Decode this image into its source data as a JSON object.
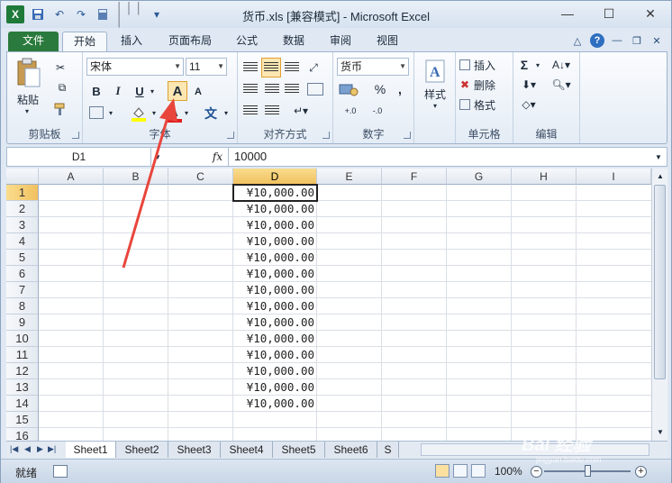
{
  "window": {
    "title": "货币.xls  [兼容模式] - Microsoft Excel",
    "minimize": "—",
    "maximize": "☐",
    "close": "✕"
  },
  "qat": {
    "logo": "X",
    "save": "💾",
    "undo": "↶",
    "redo": "↷",
    "more": "▾"
  },
  "tabs": [
    "文件",
    "开始",
    "插入",
    "页面布局",
    "公式",
    "数据",
    "审阅",
    "视图"
  ],
  "ribbon": {
    "clipboard": {
      "label": "剪贴板",
      "paste": "粘贴"
    },
    "font": {
      "label": "字体",
      "name": "宋体",
      "size": "11",
      "bold": "B",
      "italic": "I",
      "underline": "U",
      "grow": "A",
      "shrink": "A",
      "font_color": "A",
      "wen": "文"
    },
    "alignment": {
      "label": "对齐方式"
    },
    "number": {
      "label": "数字",
      "format": "货币",
      "percent": "%",
      "comma": ",",
      "inc": "+.0",
      "dec": "-.0"
    },
    "styles": {
      "label": "样式"
    },
    "cells": {
      "label": "单元格",
      "insert": "插入",
      "delete": "删除",
      "format": "格式"
    },
    "editing": {
      "label": "编辑",
      "sum": "Σ"
    }
  },
  "formula_bar": {
    "name_box": "D1",
    "fx": "fx",
    "value": "10000"
  },
  "columns": [
    "A",
    "B",
    "C",
    "D",
    "E",
    "F",
    "G",
    "H",
    "I"
  ],
  "selected_column": "D",
  "rows": [
    "1",
    "2",
    "3",
    "4",
    "5",
    "6",
    "7",
    "8",
    "9",
    "10",
    "11",
    "12",
    "13",
    "14",
    "15",
    "16"
  ],
  "cells_D": [
    "¥10,000.00",
    "¥10,000.00",
    "¥10,000.00",
    "¥10,000.00",
    "¥10,000.00",
    "¥10,000.00",
    "¥10,000.00",
    "¥10,000.00",
    "¥10,000.00",
    "¥10,000.00",
    "¥10,000.00",
    "¥10,000.00",
    "¥10,000.00",
    "¥10,000.00"
  ],
  "sheets": [
    "Sheet1",
    "Sheet2",
    "Sheet3",
    "Sheet4",
    "Sheet5",
    "Sheet6",
    "S"
  ],
  "active_sheet": "Sheet1",
  "status": {
    "ready": "就绪",
    "zoom": "100%",
    "minus": "−",
    "plus": "+"
  },
  "annotation_color": "#e8463c",
  "watermark": {
    "brand": "Bai 经验",
    "url": "jingyan.baidu.com"
  }
}
